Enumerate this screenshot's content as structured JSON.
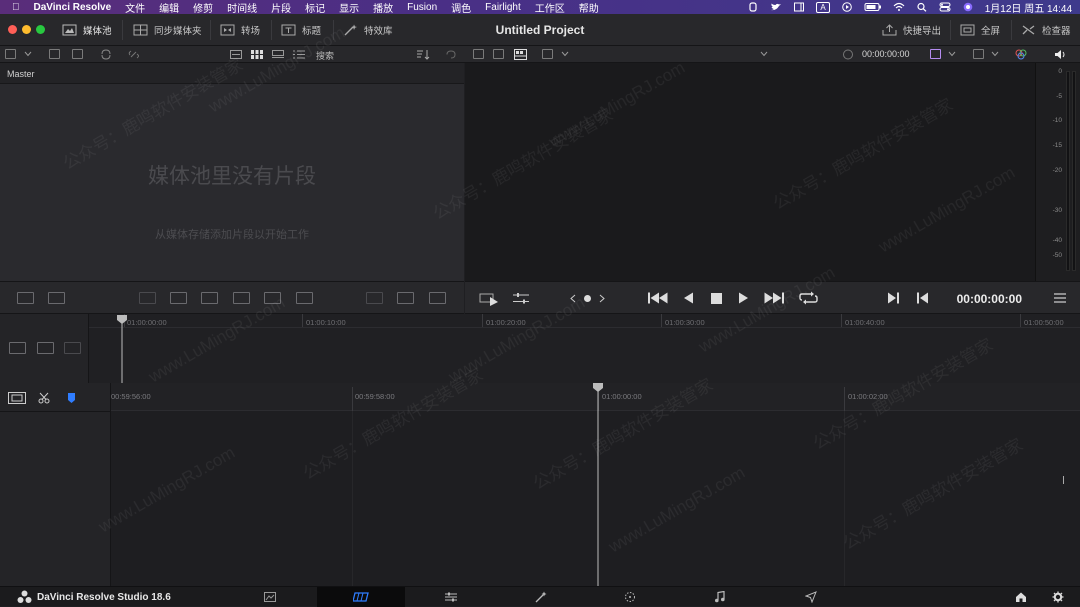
{
  "menubar": {
    "app_name": "DaVinci Resolve",
    "items": [
      "文件",
      "编辑",
      "修剪",
      "时间线",
      "片段",
      "标记",
      "显示",
      "播放",
      "Fusion",
      "调色",
      "Fairlight",
      "工作区",
      "帮助"
    ],
    "clock": "1月12日 周五 14:44",
    "input_indicator": "A"
  },
  "titlebar": {
    "project_title": "Untitled Project",
    "left_buttons": [
      {
        "label": "媒体池",
        "icon": "media-pool-icon"
      },
      {
        "label": "同步媒体夹",
        "icon": "sync-bin-icon"
      },
      {
        "label": "转场",
        "icon": "transitions-icon"
      },
      {
        "label": "标题",
        "icon": "titles-icon"
      },
      {
        "label": "特效库",
        "icon": "effects-icon"
      }
    ],
    "right_buttons": [
      {
        "label": "快捷导出",
        "icon": "quick-export-icon"
      },
      {
        "label": "全屏",
        "icon": "fullscreen-icon"
      },
      {
        "label": "检查器",
        "icon": "inspector-icon"
      }
    ]
  },
  "toolbar": {
    "search_label": "搜索",
    "viewer_timecode": "00:00:00:00"
  },
  "media_pool": {
    "bin_name": "Master",
    "empty_title": "媒体池里没有片段",
    "empty_hint": "从媒体存储添加片段以开始工作"
  },
  "audio_meter": {
    "scale": [
      "0",
      "-5",
      "-10",
      "-15",
      "-20",
      "-30",
      "-40",
      "-50"
    ]
  },
  "transport": {
    "timecode": "00:00:00:00"
  },
  "upper_timeline": {
    "ticks": [
      "01:00:00:00",
      "01:00:10:00",
      "01:00:20:00",
      "01:00:30:00",
      "01:00:40:00",
      "01:00:50:00"
    ]
  },
  "lower_timeline": {
    "ticks": [
      "00:59:56:00",
      "00:59:58:00",
      "01:00:00:00",
      "01:00:02:00"
    ]
  },
  "pagebar": {
    "brand": "DaVinci Resolve Studio 18.6",
    "pages": [
      "media",
      "cut",
      "edit",
      "fusion",
      "color",
      "fairlight",
      "deliver"
    ],
    "active_page": "cut"
  },
  "watermark": {
    "text": "公众号：鹿鸣软件安装管家",
    "url": "www.LuMingRJ.com"
  },
  "colors": {
    "accent_blue": "#2f7dff",
    "menubar_gradient_start": "#5a2d7a",
    "traffic_red": "#ff5f57",
    "traffic_yellow": "#febc2e",
    "traffic_green": "#28c840"
  }
}
